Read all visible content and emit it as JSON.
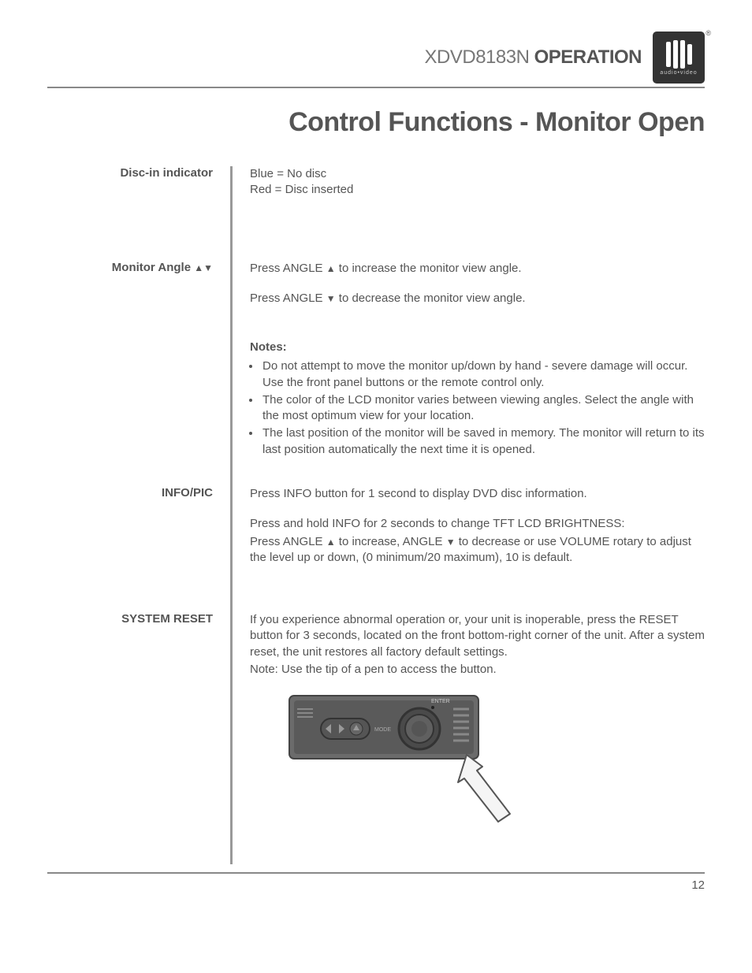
{
  "header": {
    "model": "XDVD8183N",
    "operation": "OPERATION",
    "logo_sub": "audio•video"
  },
  "title": "Control Functions - Monitor Open",
  "sections": {
    "disc": {
      "label": "Disc-in indicator",
      "line1": "Blue = No disc",
      "line2": "Red  = Disc inserted"
    },
    "angle": {
      "label_pre": "Monitor Angle ",
      "p1_pre": "Press ",
      "p1_bold": "ANGLE ",
      "p1_post": " to increase the monitor view angle.",
      "p2_pre": "Press ",
      "p2_bold": "ANGLE ",
      "p2_post": " to decrease the monitor view angle."
    },
    "notes": {
      "label": "Notes:",
      "n1": "Do not attempt to move the monitor up/down by hand - severe damage will occur. Use the front panel buttons or the remote control only.",
      "n2": "The color of the LCD monitor varies between viewing angles. Select the angle with the most optimum view for your location.",
      "n3": "The last position of the monitor will be saved in memory. The monitor will return to its last position automatically the next time it is opened."
    },
    "info": {
      "label": "INFO/PIC",
      "p1_pre": "Press ",
      "p1_bold": "INFO",
      "p1_post": " button for 1 second to display DVD disc information.",
      "p2_pre": "Press and hold ",
      "p2_bold": "INFO",
      "p2_mid": " for 2 seconds to change TFT LCD ",
      "p2_bold2": "BRIGHTNESS:",
      "p3_pre": "Press ",
      "p3_bold": "ANGLE ",
      "p3_mid": " to increase, ",
      "p3_bold2": "ANGLE ",
      "p3_mid2": " to decrease or use ",
      "p3_bold3": "VOLUME",
      "p3_post": " rotary to adjust the level up or down, (0 minimum/20 maximum), 10 is default."
    },
    "reset": {
      "label": "SYSTEM RESET",
      "p1_pre": "If you experience abnormal operation or, your unit is inoperable, press the ",
      "p1_bold": "RESET",
      "p1_post": " button for 3 seconds, located on the front bottom-right corner of the unit. After a system reset, the unit restores all factory default settings.",
      "note_bold": "Note:",
      "note_rest": " Use the tip of a pen to access the button."
    }
  },
  "footer": {
    "page": "12"
  }
}
